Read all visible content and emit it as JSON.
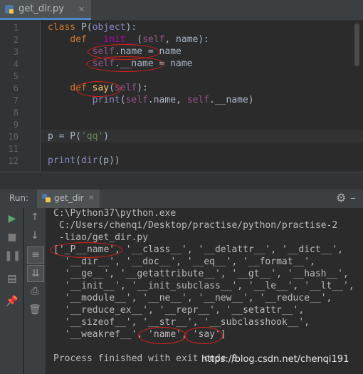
{
  "editor_tab": {
    "title": "get_dir.py",
    "close": "×"
  },
  "editor": {
    "line_numbers": [
      "1",
      "2",
      "3",
      "4",
      "5",
      "6",
      "7",
      "8",
      "9",
      "10",
      "11",
      "12"
    ]
  },
  "run_panel": {
    "label": "Run:",
    "tab_title": "get_dir",
    "tab_close": "×",
    "settings_icon": "gear-icon",
    "minimize_icon": "minimize-icon",
    "output_lines": [
      "C:\\Python37\\python.exe",
      " C:/Users/chenqi/Desktop/practise/python/practise-2",
      " -liao/get_dir.py",
      "['_P__name', '__class__', '__delattr__', '__dict__',",
      "  '__dir__', '__doc__', '__eq__', '__format__',",
      "  '__ge__', '__getattribute__', '__gt__', '__hash__',",
      "  '__init__', '__init_subclass__', '__le__', '__lt__',",
      "  '__module__', '__ne__', '__new__', '__reduce__',",
      "  '__reduce_ex__', '__repr__', '__setattr__',",
      "  '__sizeof__', '__str__', '__subclasshook__',",
      "  '__weakref__', 'name', 'say']",
      "",
      "Process finished with exit code 0"
    ],
    "toolbar_icons": [
      "run-icon",
      "stop-icon",
      "pause-icon",
      "layout-icon",
      "soft-wrap-icon",
      "pin-icon",
      "up-arrow-icon",
      "down-arrow-icon",
      "scroll-to-end-icon",
      "print-icon",
      "delete-icon"
    ]
  },
  "watermark": "https://blog.csdn.net/chenqi191",
  "colors": {
    "background": "#2b2b2b",
    "keyword": "#cc7832",
    "function": "#ffc66d",
    "string": "#6a8759",
    "annotation": "#e0201a"
  }
}
